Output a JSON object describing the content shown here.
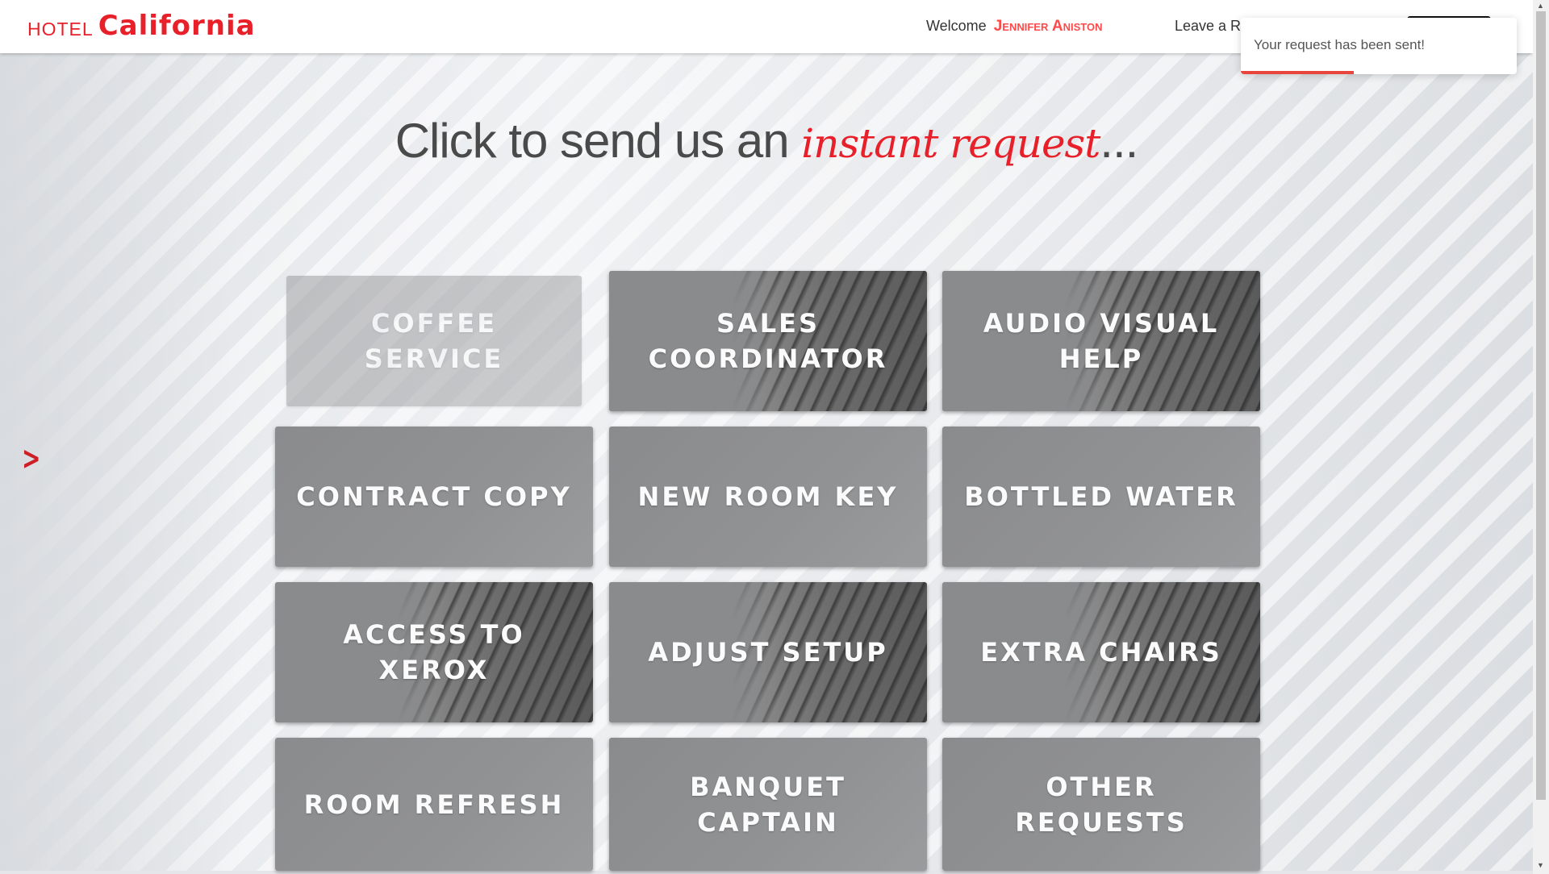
{
  "header": {
    "brand_prefix": "HOTEL",
    "brand_name": "California",
    "welcome_label": "Welcome",
    "user_name": "Jennifer Aniston",
    "leave_link": "Leave a R"
  },
  "toast": {
    "message": "Your request has been sent!",
    "progress": 0.41
  },
  "heading": {
    "text": "Click to send us an",
    "emphasis": "instant request",
    "suffix": "..."
  },
  "tiles": [
    {
      "label": "Coffee Service"
    },
    {
      "label": "Sales Coordinator"
    },
    {
      "label": "Audio Visual Help"
    },
    {
      "label": "Contract Copy"
    },
    {
      "label": "New Room Key"
    },
    {
      "label": "Bottled Water"
    },
    {
      "label": "Access to Xerox"
    },
    {
      "label": "Adjust Setup"
    },
    {
      "label": "Extra Chairs"
    },
    {
      "label": "Room Refresh"
    },
    {
      "label": "Banquet Captain"
    },
    {
      "label": "Other Requests"
    }
  ],
  "icons": {
    "next": "chevron-right-icon"
  },
  "colors": {
    "brand": "#e8202a",
    "toast_progress": "#e8453c"
  }
}
